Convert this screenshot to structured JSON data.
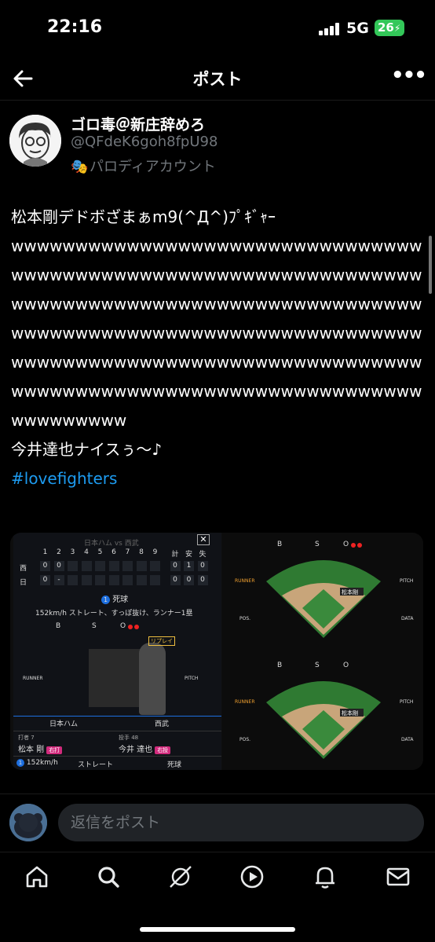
{
  "status": {
    "time": "22:16",
    "network": "5G",
    "battery": "26"
  },
  "header": {
    "title": "ポスト"
  },
  "author": {
    "name": "ゴロ毒＠新庄辞めろ",
    "handle": "@QFdeK6goh8fpU98",
    "label": "パロディアカウント"
  },
  "tweet": {
    "line1": "松本剛デドボざまぁm9(^Д^)ﾌﾟｷﾞｬｰ",
    "laugh": "wwwwwwwwwwwwwwwwwwwwwwwwwwwwwwwwwwwwwwwwwwwwwwwwwwwwwwwwwwwwwwwwwwwwwwwwwwwwwwwwwwwwwwwwwwwwwwwwwwwwwwwwwwwwwwwwwwwwwwwwwwwwwwwwwwwwwwwwwwwwwwwwwwwwwwwwwwwwwwwwwwwwwwwwwwwwwwwwwwwwwwwwwwwwwwwwwwwwwwwww",
    "line3": "今井達也ナイスぅ〜♪",
    "hashtag": "#lovefighters"
  },
  "media": {
    "game_title": "日本ハム vs 西武",
    "innings": [
      "1",
      "2",
      "3",
      "4",
      "5",
      "6",
      "7",
      "8",
      "9",
      "計",
      "安",
      "失"
    ],
    "team_top": "西",
    "team_bottom": "日",
    "top_scores": [
      "0",
      "0",
      "",
      "",
      "",
      "",
      "",
      "",
      "",
      "0",
      "1",
      "0"
    ],
    "bottom_scores": [
      "0",
      "-",
      "",
      "",
      "",
      "",
      "",
      "",
      "",
      "0",
      "0",
      "0"
    ],
    "event_no": "1",
    "event": "死球",
    "pitch_desc": "152km/h ストレート、すっぽ抜け、ランナー1塁",
    "bso": {
      "b": "B",
      "s": "S",
      "o": "O"
    },
    "replay": "リプレイ",
    "runner": "RUNNER",
    "pitch": "PITCH",
    "pos": "POS.",
    "data": "DATA",
    "home_team": "日本ハム",
    "away_team": "西武",
    "batter_label": "打者 7",
    "batter": "松本 剛",
    "batter_hand": "右打",
    "pitcher_label": "投手 48",
    "pitcher": "今井 達也",
    "pitcher_hand": "右投",
    "speed": "152km/h",
    "pitch_type": "ストレート",
    "result": "死球",
    "field_player": "松本剛"
  },
  "reply": {
    "placeholder": "返信をポスト"
  },
  "tabs": [
    "home-icon",
    "search-icon",
    "grok-icon",
    "video-icon",
    "bell-icon",
    "mail-icon"
  ]
}
